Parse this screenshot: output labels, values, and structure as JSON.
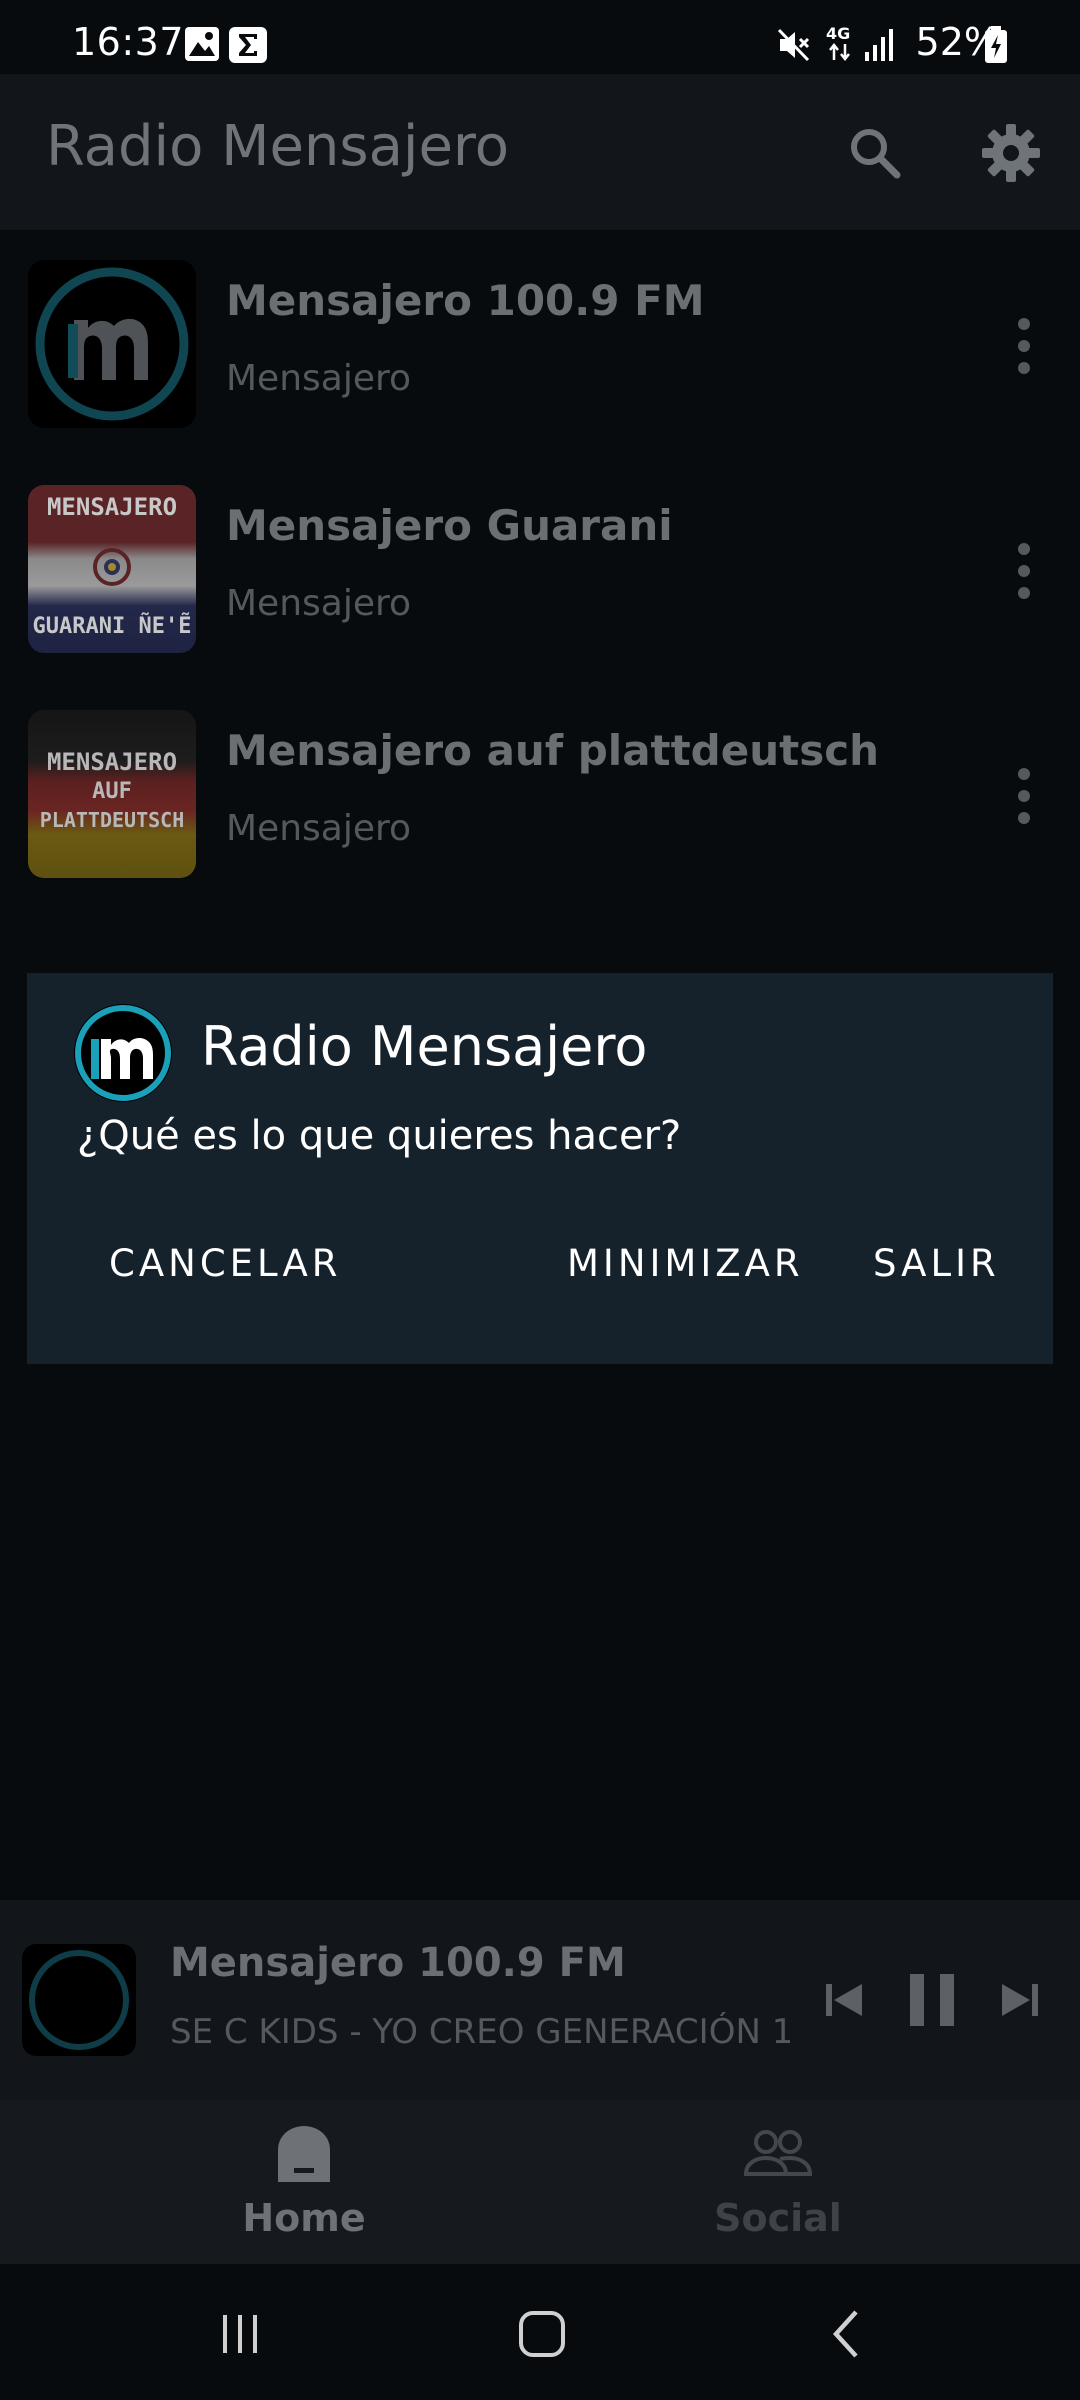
{
  "status_bar": {
    "time": "16:37",
    "battery": "52%",
    "network": "4G",
    "icons": [
      "image-icon",
      "sigma-icon",
      "mute-icon",
      "data-arrows-icon",
      "signal-icon",
      "battery-charging-icon"
    ]
  },
  "app_bar": {
    "title": "Radio Mensajero",
    "icons": [
      "search-icon",
      "gear-icon"
    ]
  },
  "stations": [
    {
      "title": "Mensajero 100.9 FM",
      "subtitle": "Mensajero"
    },
    {
      "title": "Mensajero Guarani",
      "subtitle": "Mensajero",
      "thumb_top": "MENSAJERO",
      "thumb_bottom": "GUARANI ÑE'Ẽ"
    },
    {
      "title": "Mensajero auf plattdeutsch",
      "subtitle": "Mensajero",
      "thumb_lines": [
        "MENSAJERO",
        "AUF",
        "PLATTDEUTSCH"
      ]
    }
  ],
  "dialog": {
    "title": "Radio Mensajero",
    "message": "¿Qué es lo que quieres hacer?",
    "cancel_label": "CANCELAR",
    "minimize_label": "MINIMIZAR",
    "exit_label": "SALIR"
  },
  "player": {
    "title": "Mensajero 100.9 FM",
    "now_playing": "SE C KIDS - YO CREO GENERACIÓN 1"
  },
  "nav": {
    "home_label": "Home",
    "social_label": "Social"
  },
  "colors": {
    "background": "#080b0e",
    "app_bar": "#12161b",
    "dialog": "#16222b",
    "accent": "#1aa0b8"
  }
}
